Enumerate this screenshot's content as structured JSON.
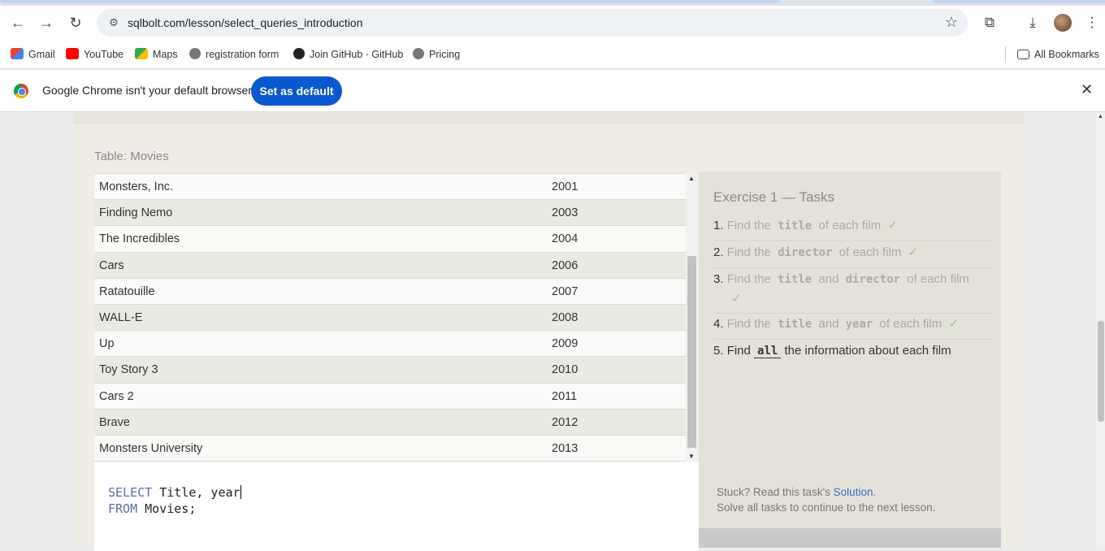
{
  "browser": {
    "url": "sqlbolt.com/lesson/select_queries_introduction",
    "bookmarks": [
      "Gmail",
      "YouTube",
      "Maps",
      "registration form",
      "Join GitHub · GitHub",
      "Pricing"
    ],
    "all_bookmarks": "All Bookmarks",
    "infobar_message": "Google Chrome isn't your default browser",
    "infobar_button": "Set as default"
  },
  "table": {
    "label": "Table: Movies",
    "rows": [
      {
        "title": "Monsters, Inc.",
        "year": "2001"
      },
      {
        "title": "Finding Nemo",
        "year": "2003"
      },
      {
        "title": "The Incredibles",
        "year": "2004"
      },
      {
        "title": "Cars",
        "year": "2006"
      },
      {
        "title": "Ratatouille",
        "year": "2007"
      },
      {
        "title": "WALL-E",
        "year": "2008"
      },
      {
        "title": "Up",
        "year": "2009"
      },
      {
        "title": "Toy Story 3",
        "year": "2010"
      },
      {
        "title": "Cars 2",
        "year": "2011"
      },
      {
        "title": "Brave",
        "year": "2012"
      },
      {
        "title": "Monsters University",
        "year": "2013"
      }
    ]
  },
  "editor": {
    "line1_keyword": "SELECT",
    "line1_rest": " Title, year",
    "line2_keyword": "FROM",
    "line2_rest": " Movies;"
  },
  "tasks": {
    "title": "Exercise 1 — Tasks",
    "items": [
      {
        "num": "1.",
        "pre": "Find the",
        "code": "title",
        "post": "of each film",
        "done": true
      },
      {
        "num": "2.",
        "pre": "Find the",
        "code": "director",
        "post": "of each film",
        "done": true
      },
      {
        "num": "3.",
        "pre": "Find the",
        "code": "title",
        "mid": "and",
        "code2": "director",
        "post": "of each film",
        "done": true
      },
      {
        "num": "4.",
        "pre": "Find the",
        "code": "title",
        "mid": "and",
        "code2": "year",
        "post": "of each film",
        "done": true
      },
      {
        "num": "5.",
        "pre": "Find",
        "code": "all",
        "post": "the information about each film",
        "done": false
      }
    ],
    "check": "✓",
    "stuck_text": "Stuck? Read this task's",
    "solution_link": "Solution",
    "continue_text": "Solve all tasks to continue to the next lesson."
  }
}
